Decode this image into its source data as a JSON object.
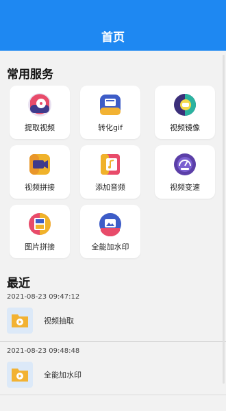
{
  "header": {
    "title": "首页"
  },
  "services": {
    "title": "常用服务",
    "items": [
      {
        "label": "提取视频",
        "icon": "film-reel-icon"
      },
      {
        "label": "转化gif",
        "icon": "gif-convert-icon"
      },
      {
        "label": "视频镜像",
        "icon": "mirror-icon"
      },
      {
        "label": "视频拼接",
        "icon": "video-camera-icon"
      },
      {
        "label": "添加音频",
        "icon": "add-audio-icon"
      },
      {
        "label": "视频变速",
        "icon": "speedometer-icon"
      },
      {
        "label": "图片拼接",
        "icon": "photo-collage-icon"
      },
      {
        "label": "全能加水印",
        "icon": "watermark-image-icon"
      }
    ]
  },
  "recent": {
    "title": "最近",
    "items": [
      {
        "time": "2021-08-23 09:47:12",
        "name": "视频抽取"
      },
      {
        "time": "2021-08-23 09:48:48",
        "name": "全能加水印"
      }
    ]
  },
  "colors": {
    "header": "#1e88f2",
    "background": "#f2f2f2",
    "card": "#ffffff"
  }
}
